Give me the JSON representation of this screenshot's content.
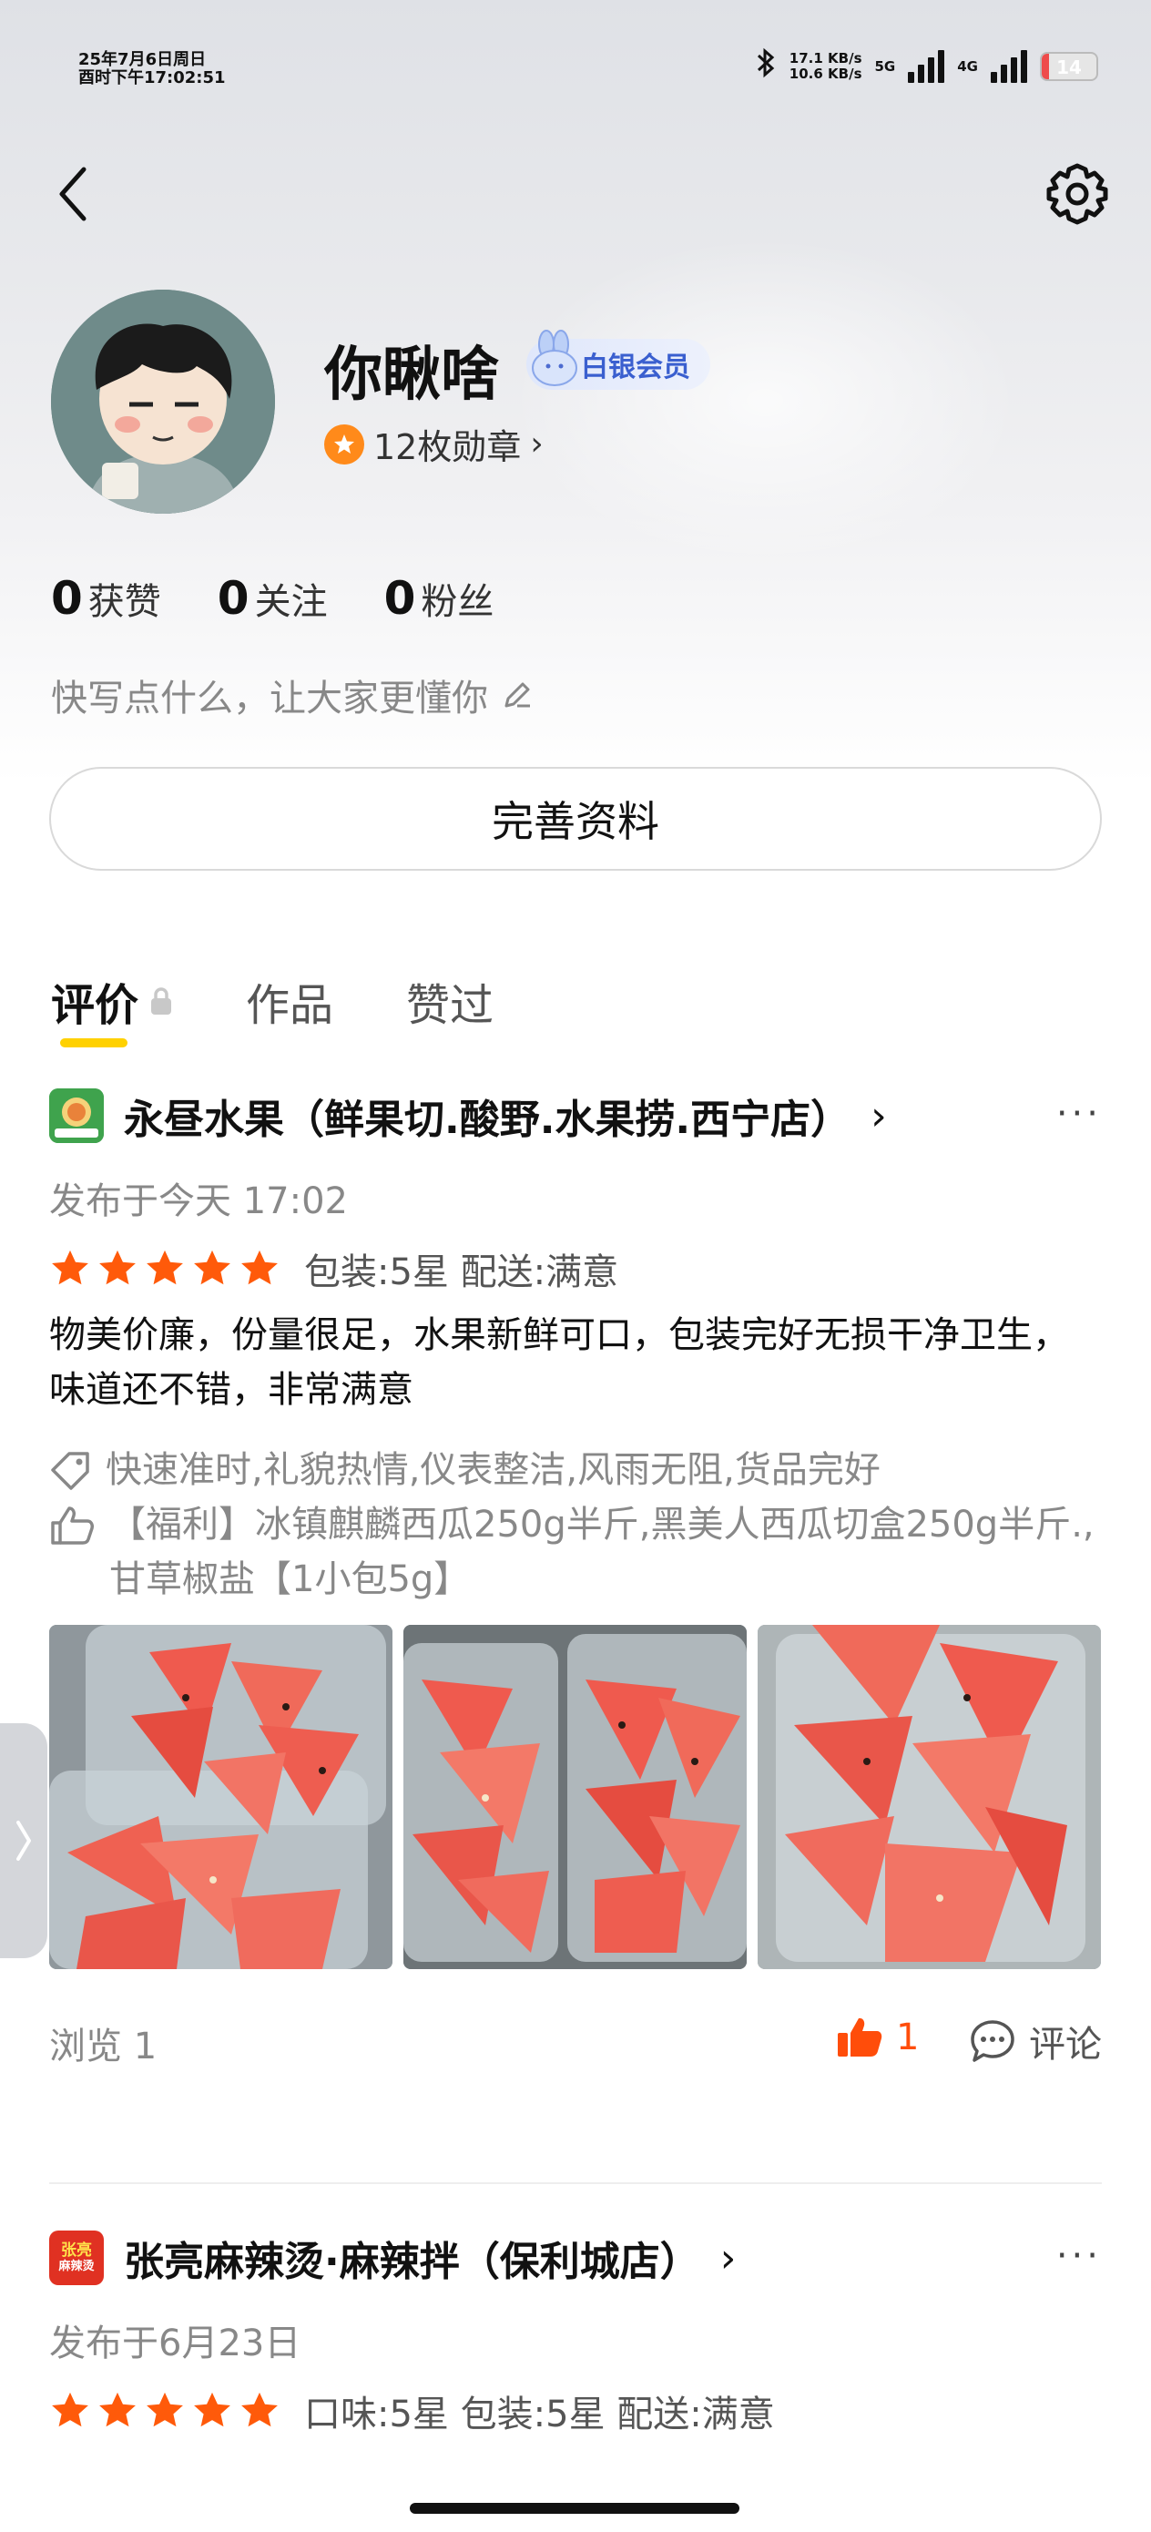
{
  "status_bar": {
    "datetime_line1": "25年7月6日周日",
    "datetime_line2": "酉时下午17:02:51",
    "speed_up": "17.1 KB/s",
    "speed_down": "10.6 KB/s",
    "net1": "5G",
    "net2": "4G",
    "battery": "14",
    "battery_level": 0.14
  },
  "nav": {
    "back_icon": "back-icon",
    "settings_icon": "gear-icon"
  },
  "profile": {
    "name": "你瞅啥",
    "membership": "白银会员",
    "medals": "12枚勋章",
    "stats": [
      {
        "num": "0",
        "label": "获赞"
      },
      {
        "num": "0",
        "label": "关注"
      },
      {
        "num": "0",
        "label": "粉丝"
      }
    ],
    "bio_placeholder": "快写点什么，让大家更懂你",
    "edit_button": "完善资料"
  },
  "tabs": [
    {
      "label": "评价",
      "active": true,
      "locked": true
    },
    {
      "label": "作品",
      "active": false
    },
    {
      "label": "赞过",
      "active": false
    }
  ],
  "reviews": [
    {
      "shop": "永昼水果（鲜果切.酸野.水果捞.西宁店）",
      "date": "发布于今天 17:02",
      "stars": 5,
      "rating_text": "包装:5星 配送:满意",
      "text": "物美价廉，份量很足，水果新鲜可口，包装完好无损干净卫生，味道还不错，非常满意",
      "tags": "快速准时,礼貌热情,仪表整洁,风雨无阻,货品完好",
      "liked_items": "【福利】冰镇麒麟西瓜250g半斤,黑美人西瓜切盒250g半斤.,甘草椒盐【1小包5g】",
      "views": "浏览 1",
      "likes": "1",
      "comment_label": "评论"
    },
    {
      "shop": "张亮麻辣烫·麻辣拌（保利城店）",
      "logo_text_1": "张亮",
      "logo_text_2": "麻辣烫",
      "date": "发布于6月23日",
      "stars": 5,
      "rating_text": "口味:5星 包装:5星 配送:满意"
    }
  ],
  "colors": {
    "accent": "#ffd100",
    "star": "#ff5a0a",
    "like": "#ff4d0a"
  }
}
